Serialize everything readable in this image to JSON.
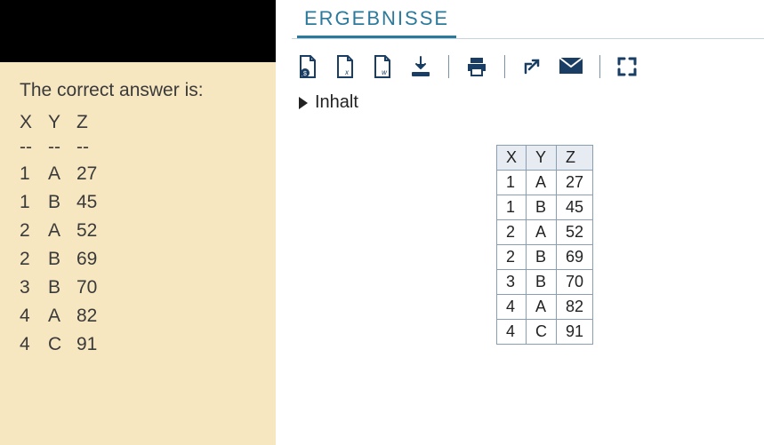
{
  "left": {
    "title": "The correct answer is:",
    "columns": [
      "X",
      "Y",
      "Z"
    ],
    "dashes": [
      "--",
      "--",
      "--"
    ],
    "rows": [
      [
        "1",
        "A",
        "27"
      ],
      [
        "1",
        "B",
        "45"
      ],
      [
        "2",
        "A",
        "52"
      ],
      [
        "2",
        "B",
        "69"
      ],
      [
        "3",
        "B",
        "70"
      ],
      [
        "4",
        "A",
        "82"
      ],
      [
        "4",
        "C",
        "91"
      ]
    ]
  },
  "right": {
    "tab": "ERGEBNISSE",
    "section": "Inhalt",
    "toolbar_icons": [
      "export-excel-icon",
      "export-xml-icon",
      "export-word-icon",
      "download-icon",
      "print-icon",
      "open-external-icon",
      "email-icon",
      "fullscreen-icon"
    ],
    "table": {
      "columns": [
        "X",
        "Y",
        "Z"
      ],
      "rows": [
        [
          "1",
          "A",
          "27"
        ],
        [
          "1",
          "B",
          "45"
        ],
        [
          "2",
          "A",
          "52"
        ],
        [
          "2",
          "B",
          "69"
        ],
        [
          "3",
          "B",
          "70"
        ],
        [
          "4",
          "A",
          "82"
        ],
        [
          "4",
          "C",
          "91"
        ]
      ]
    }
  }
}
